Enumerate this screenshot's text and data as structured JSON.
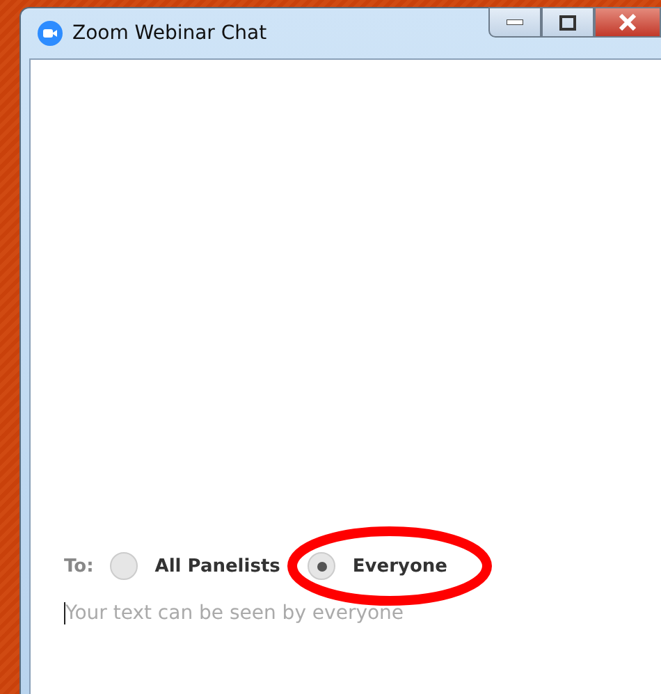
{
  "window": {
    "title": "Zoom Webinar Chat"
  },
  "recipient": {
    "label": "To:",
    "options": [
      {
        "label": "All Panelists",
        "selected": false
      },
      {
        "label": "Everyone",
        "selected": true
      }
    ]
  },
  "message": {
    "placeholder": "Your text can be seen by everyone"
  },
  "annotation": {
    "kind": "ellipse"
  }
}
